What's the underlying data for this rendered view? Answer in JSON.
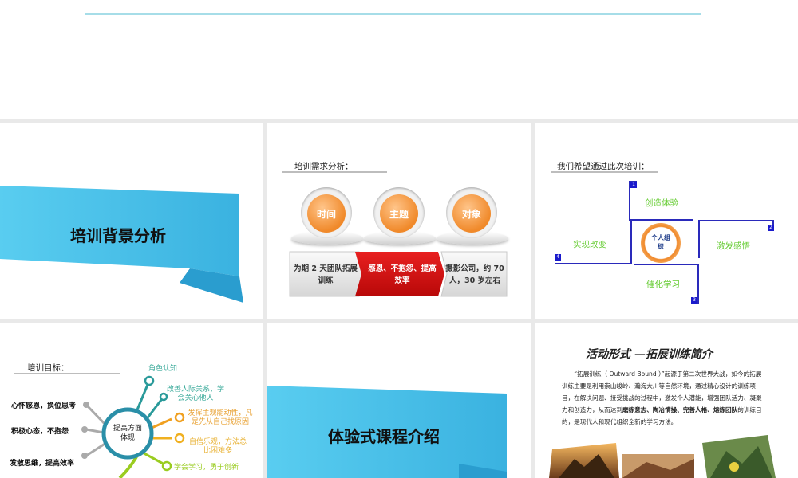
{
  "slide2": {
    "heading": "培训需求分析：",
    "circles": [
      "时间",
      "主题",
      "对象"
    ],
    "boxes": [
      "为期 2 天团队拓展训练",
      "感恩、不抱怨、提高效率",
      "摄影公司，约 70 人，30 岁左右"
    ]
  },
  "slide1": {
    "title": "培训背景分析"
  },
  "slide3": {
    "heading": "我们希望通过此次培训：",
    "center": "个人组织",
    "labels": [
      "创造体验",
      "激发感悟",
      "催化学习",
      "实现改变"
    ],
    "numbers": [
      "1",
      "2",
      "3",
      "4"
    ]
  },
  "slide4": {
    "heading": "培训目标：",
    "center": "提高方面体现",
    "left": [
      "心怀感恩，换位思考",
      "积极心态，不抱怨",
      "发散思维，提高效率"
    ],
    "right": [
      "角色认知",
      "改善人际关系，学会关心他人",
      "发挥主观能动性，凡是先从自己找原因",
      "自信乐观，方法总比困难多",
      "学会学习，勇于创新"
    ]
  },
  "slide5": {
    "title": "体验式课程介绍"
  },
  "slide6": {
    "title": "活动形式 —拓展训练简介",
    "paragraph_a": "“拓展训练（ Outward Bound ）”起源于第二次世界大战，如今的拓展训练主要是利用崇山峻岭、瀚海大川等自然环境，通过精心设计的训练项目，在解决问题、接受挑战的过程中，激发个人潜能，增强团队活力、凝聚力和创造力，从而达到",
    "bold_a": "磨练意志、陶冶情操、完善人格、熔炼团队",
    "paragraph_b": "的训练目的，是现代人和现代组织全新的学习方法。"
  },
  "colors": {
    "accent_blue": "#4fc3e8",
    "orange": "#f0892a",
    "red": "#d31010",
    "green": "#66cc33",
    "teal": "#2a8fa8",
    "bracket": "#2a2abb"
  }
}
